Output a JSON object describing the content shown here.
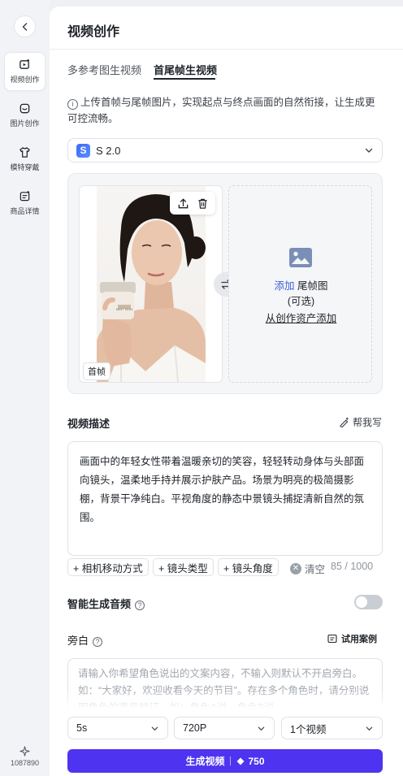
{
  "rail": {
    "items": [
      {
        "label": "视频创作",
        "icon": "video-create-icon",
        "active": true
      },
      {
        "label": "图片创作",
        "icon": "image-create-icon",
        "active": false
      },
      {
        "label": "模特穿戴",
        "icon": "tshirt-icon",
        "active": false
      },
      {
        "label": "商品详情",
        "icon": "product-detail-icon",
        "active": false
      }
    ],
    "credits": "1087890",
    "credits_icon": "sparkle-icon"
  },
  "header": {
    "title": "视频创作"
  },
  "tabs": [
    {
      "label": "多参考图生视频",
      "active": false
    },
    {
      "label": "首尾帧生视频",
      "active": true
    }
  ],
  "info": {
    "text": "上传首帧与尾帧图片，实现起点与终点画面的自然衔接，让生成更可控流畅。",
    "icon_glyph": "i"
  },
  "model": {
    "logo_letter": "S",
    "name": "S 2.0"
  },
  "frames": {
    "first_label": "首帧",
    "last_add": "添加",
    "last_label": " 尾帧图",
    "last_optional": "(可选)",
    "last_assets": "从创作资产添加",
    "jar_text": "MINT SKIN"
  },
  "description": {
    "label": "视频描述",
    "help_write": "帮我写",
    "text": "画面中的年轻女性带着温暖亲切的笑容，轻轻转动身体与头部面向镜头，温柔地手持并展示护肤产品。场景为明亮的极简摄影棚，背景干净纯白。平视角度的静态中景镜头捕捉清新自然的氛围。",
    "chips": [
      "+ 相机移动方式",
      "+ 镜头类型",
      "+ 镜头角度"
    ],
    "clear": "清空",
    "counter": "85 / 1000"
  },
  "audio": {
    "label": "智能生成音频",
    "enabled": false,
    "help_glyph": "?"
  },
  "narration": {
    "label": "旁白",
    "examples": "试用案例",
    "placeholder": "请输入你希望角色说出的文案内容，不输入则默认不开启旁白。如：“大家好，欢迎收看今天的节目”。存在多个角色时，请分别说明角色的声音特征，如：角色A说，角色B说。"
  },
  "options": {
    "duration": "5s",
    "resolution": "720P",
    "count": "1个视频"
  },
  "generate": {
    "label": "生成视频",
    "cost": "750"
  },
  "colors": {
    "accent": "#4e33f0",
    "link": "#3b5bdb",
    "toggle_off": "#c9cdd4"
  }
}
